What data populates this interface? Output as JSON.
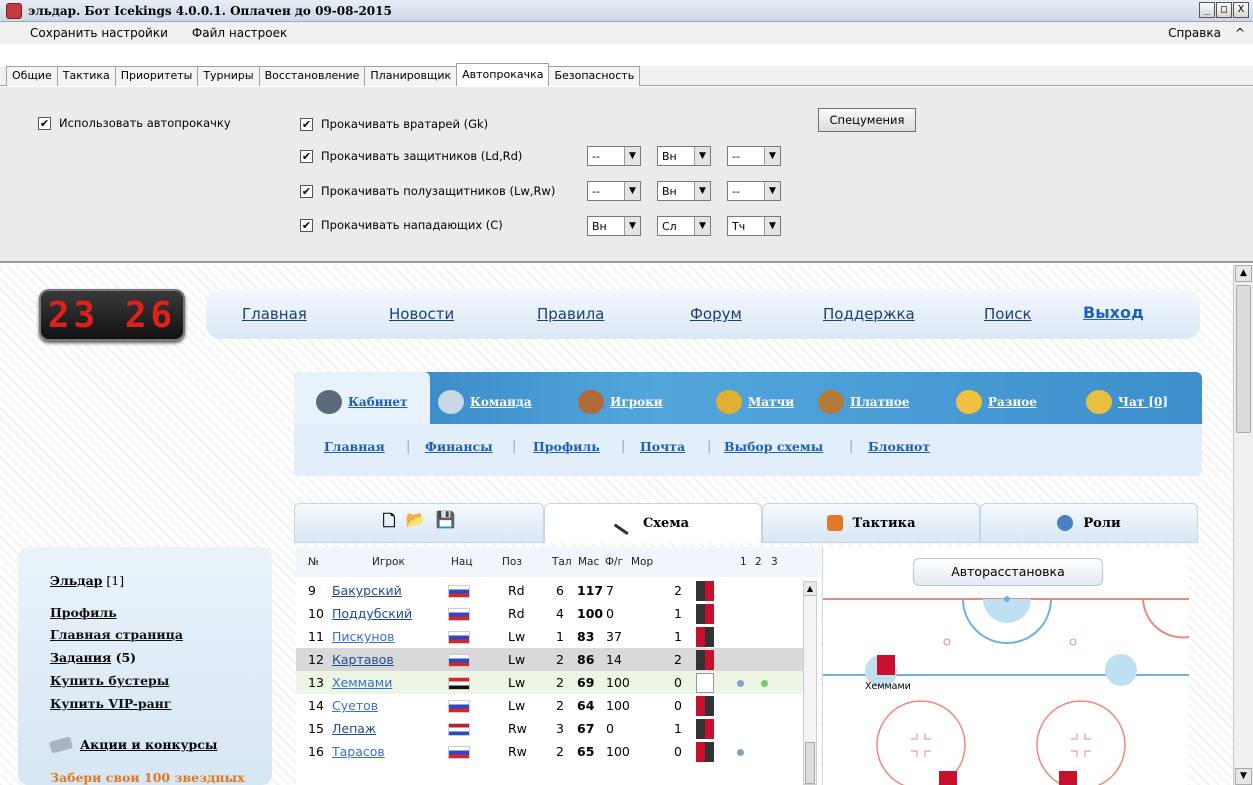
{
  "window": {
    "title": "эльдар. Бот Icekings 4.0.0.1. Оплачен до 09-08-2015",
    "min": "_",
    "max": "□",
    "close": "X"
  },
  "menu": {
    "save": "Сохранить настройки",
    "file": "Файл настроек",
    "help": "Справка",
    "collapse": "^"
  },
  "tabs": [
    "Общие",
    "Тактика",
    "Приоритеты",
    "Турниры",
    "Восстановление",
    "Планировщик",
    "Автопрокачка",
    "Безопасность"
  ],
  "settings": {
    "use_auto": "Использовать автопрокачку",
    "gk": "Прокачивать вратарей (Gk)",
    "def": "Прокачивать защитников (Ld,Rd)",
    "mid": "Прокачивать полузащитников (Lw,Rw)",
    "fwd": "Прокачивать нападающих (C)",
    "check": "✔",
    "special_button": "Спецумения",
    "def_sel": [
      "--",
      "Вн",
      "--"
    ],
    "mid_sel": [
      "--",
      "Вн",
      "--"
    ],
    "fwd_sel": [
      "Вн",
      "Сл",
      "Тч"
    ],
    "arrow": "▼"
  },
  "site": {
    "clock": "23 26",
    "nav": {
      "home": "Главная",
      "news": "Новости",
      "rules": "Правила",
      "forum": "Форум",
      "support": "Поддержка",
      "search": "Поиск",
      "logout": "Выход"
    },
    "cabinet_tabs": {
      "cabinet": "Кабинет",
      "team": "Команда",
      "players": "Игроки",
      "matches": "Матчи",
      "paid": "Платное",
      "misc": "Разное",
      "chat": "Чат [0]"
    },
    "sub_tabs": {
      "home": "Главная",
      "finance": "Финансы",
      "profile": "Профиль",
      "mail": "Почта",
      "scheme": "Выбор схемы",
      "notebook": "Блокнот",
      "sep": "|"
    },
    "tool_tabs": {
      "scheme": "Схема",
      "tactics": "Тактика",
      "roles": "Роли",
      "file_new": "🗋",
      "file_open": "📂",
      "file_save": "💾"
    },
    "left": {
      "user": "Эльдар",
      "user_level": "[1]",
      "profile": "Профиль",
      "main": "Главная страница",
      "tasks": "Задания",
      "tasks_count": "(5)",
      "boosters": "Купить бустеры",
      "vip": "Купить VIP-ранг",
      "promo": "Акции и конкурсы",
      "promo_text": "Забери свои 100 звездных"
    },
    "auto_arrange": "Авторасстановка",
    "rink_player": "Хеммами"
  },
  "table": {
    "headers": {
      "num": "№",
      "player": "Игрок",
      "nat": "Нац",
      "pos": "Поз",
      "tal": "Тал",
      "mas": "Мас",
      "fg": "Ф/г",
      "mor": "Мор",
      "l1": "1",
      "l2": "2",
      "l3": "3"
    },
    "rows": [
      {
        "n": "9",
        "name": "Бакурский",
        "pos": "Rd",
        "tal": "6",
        "mas": "117",
        "fg": "7",
        "mor": "2"
      },
      {
        "n": "10",
        "name": "Поддубский",
        "pos": "Rd",
        "tal": "4",
        "mas": "100",
        "fg": "0",
        "mor": "1"
      },
      {
        "n": "11",
        "name": "Пискунов",
        "pos": "Lw",
        "tal": "1",
        "mas": "83",
        "fg": "37",
        "mor": "1"
      },
      {
        "n": "12",
        "name": "Картавов",
        "pos": "Lw",
        "tal": "2",
        "mas": "86",
        "fg": "14",
        "mor": "2"
      },
      {
        "n": "13",
        "name": "Хеммами",
        "pos": "Lw",
        "tal": "2",
        "mas": "69",
        "fg": "100",
        "mor": "0"
      },
      {
        "n": "14",
        "name": "Суетов",
        "pos": "Lw",
        "tal": "2",
        "mas": "64",
        "fg": "100",
        "mor": "0"
      },
      {
        "n": "15",
        "name": "Лепаж",
        "pos": "Rw",
        "tal": "3",
        "mas": "67",
        "fg": "0",
        "mor": "1"
      },
      {
        "n": "16",
        "name": "Тарасов",
        "pos": "Rw",
        "tal": "2",
        "mas": "65",
        "fg": "100",
        "mor": "0"
      }
    ],
    "scroll_up": "▲"
  },
  "colors": {
    "accent": "#2f7fc0",
    "link": "#1d4d8f",
    "clock": "#e0201a",
    "jersey": "#c8102e",
    "dot_blue": "#7fa3c2",
    "dot_green": "#7bc96f"
  }
}
